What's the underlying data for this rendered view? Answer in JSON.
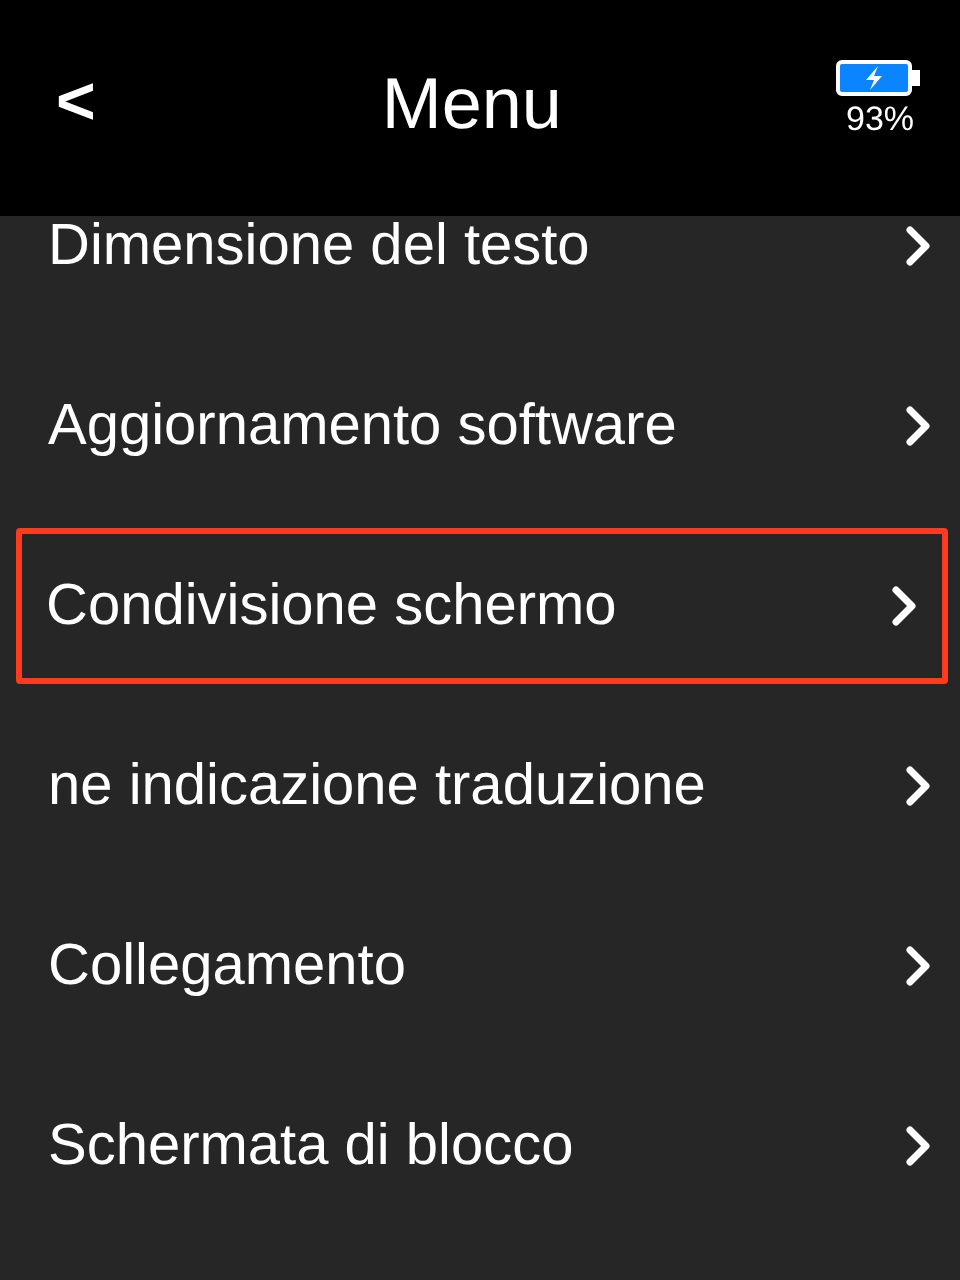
{
  "header": {
    "back": "<",
    "title": "Menu",
    "battery": "93%"
  },
  "items": [
    {
      "label": "Dimensione del testo",
      "selected": false
    },
    {
      "label": "Aggiornamento software",
      "selected": false
    },
    {
      "label": "Condivisione schermo",
      "selected": true
    },
    {
      "label": "ne indicazione traduzione",
      "selected": false
    },
    {
      "label": "Collegamento",
      "selected": false
    },
    {
      "label": "Schermata di blocco",
      "selected": false
    }
  ]
}
